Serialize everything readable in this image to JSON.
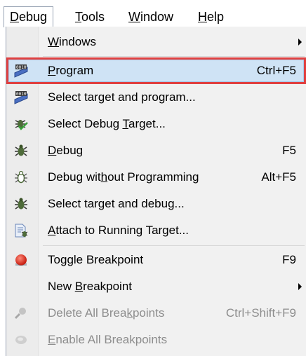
{
  "menubar": {
    "items": [
      {
        "pre": "",
        "key": "D",
        "post": "ebug"
      },
      {
        "pre": "",
        "key": "T",
        "post": "ools"
      },
      {
        "pre": "",
        "key": "W",
        "post": "indow"
      },
      {
        "pre": "",
        "key": "H",
        "post": "elp"
      }
    ]
  },
  "menu": {
    "items": [
      {
        "pre": "",
        "key": "W",
        "post": "indows",
        "shortcut": "",
        "icon": "none"
      },
      {
        "pre": "",
        "key": "P",
        "post": "rogram",
        "shortcut": "Ctrl+F5",
        "icon": "chip-program-icon"
      },
      {
        "pre": "Select target and program...",
        "key": "",
        "post": "",
        "shortcut": "",
        "icon": "chip-program-icon"
      },
      {
        "pre": "Select Debug ",
        "key": "T",
        "post": "arget...",
        "shortcut": "",
        "icon": "bug-check-icon"
      },
      {
        "pre": "",
        "key": "D",
        "post": "ebug",
        "shortcut": "F5",
        "icon": "bug-icon"
      },
      {
        "pre": "Debug wit",
        "key": "h",
        "post": "out Programming",
        "shortcut": "Alt+F5",
        "icon": "bug-outline-icon"
      },
      {
        "pre": "Select target and debug...",
        "key": "",
        "post": "",
        "shortcut": "",
        "icon": "bug-icon"
      },
      {
        "pre": "",
        "key": "A",
        "post": "ttach to Running Target...",
        "shortcut": "",
        "icon": "attach-document-icon"
      },
      {
        "pre": "To",
        "key": "g",
        "post": "gle Breakpoint",
        "shortcut": "F9",
        "icon": "breakpoint-icon"
      },
      {
        "pre": "New ",
        "key": "B",
        "post": "reakpoint",
        "shortcut": "",
        "icon": "none"
      },
      {
        "pre": "Delete All Brea",
        "key": "k",
        "post": "points",
        "shortcut": "Ctrl+Shift+F9",
        "icon": "delete-breakpoints-icon"
      },
      {
        "pre": "",
        "key": "E",
        "post": "nable All Breakpoints",
        "shortcut": "",
        "icon": "enable-breakpoints-icon"
      }
    ]
  },
  "colors": {
    "highlight_bg": "#cfe3f5",
    "highlight_border": "#e04040",
    "disabled_text": "#8d8d8d"
  }
}
